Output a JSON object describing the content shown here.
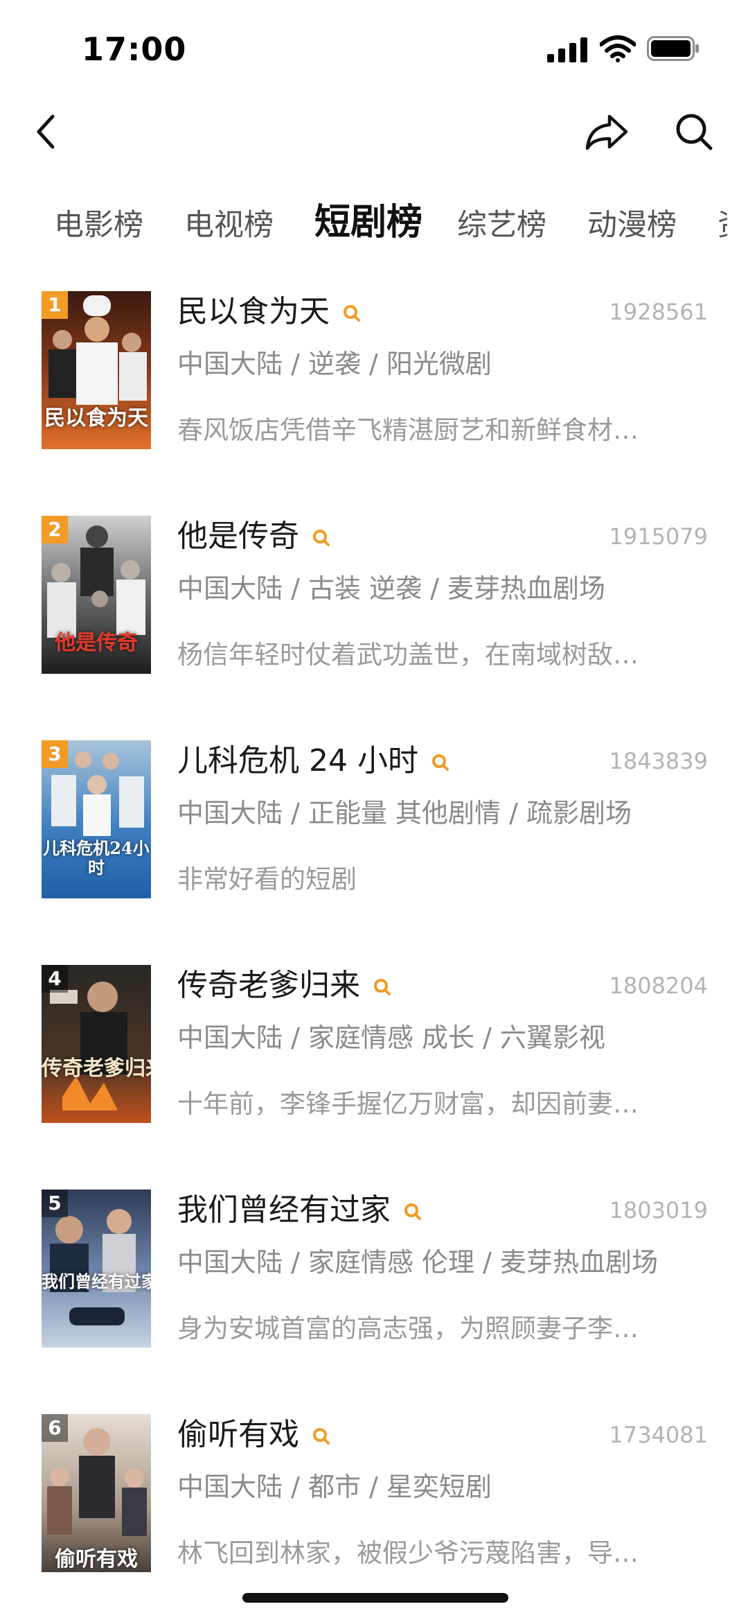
{
  "status_bar": {
    "time": "17:00"
  },
  "nav": {
    "back_icon": "chevron-left-icon",
    "share_icon": "share-icon",
    "search_icon": "search-icon"
  },
  "tabs": [
    {
      "label": "电影榜",
      "active": false
    },
    {
      "label": "电视榜",
      "active": false
    },
    {
      "label": "短剧榜",
      "active": true
    },
    {
      "label": "综艺榜",
      "active": false
    },
    {
      "label": "动漫榜",
      "active": false
    }
  ],
  "colors": {
    "accent": "#f29b26",
    "muted": "#8a8a8a",
    "score": "#b3b3b3"
  },
  "items": [
    {
      "rank": "1",
      "title": "民以食为天",
      "score": "1928561",
      "meta": "中国大陆 / 逆袭 / 阳光微剧",
      "desc": "春风饭店凭借辛飞精湛厨艺和新鲜食材…",
      "poster_caption": "民以食为天"
    },
    {
      "rank": "2",
      "title": "他是传奇",
      "score": "1915079",
      "meta": "中国大陆 / 古装 逆袭 / 麦芽热血剧场",
      "desc": "杨信年轻时仗着武功盖世，在南域树敌…",
      "poster_caption": "他是传奇"
    },
    {
      "rank": "3",
      "title": "儿科危机 24 小时",
      "score": "1843839",
      "meta": "中国大陆 / 正能量 其他剧情 / 疏影剧场",
      "desc": "非常好看的短剧",
      "poster_caption": "儿科危机24小时"
    },
    {
      "rank": "4",
      "title": "传奇老爹归来",
      "score": "1808204",
      "meta": "中国大陆 / 家庭情感 成长 / 六翼影视",
      "desc": "十年前，李锋手握亿万财富，却因前妻…",
      "poster_caption": "传奇老爹归来"
    },
    {
      "rank": "5",
      "title": "我们曾经有过家",
      "score": "1803019",
      "meta": "中国大陆 / 家庭情感 伦理 / 麦芽热血剧场",
      "desc": "身为安城首富的高志强，为照顾妻子李…",
      "poster_caption": "我们曾经有过家"
    },
    {
      "rank": "6",
      "title": "偷听有戏",
      "score": "1734081",
      "meta": "中国大陆 / 都市 / 星奕短剧",
      "desc": "林飞回到林家，被假少爷污蔑陷害，导…",
      "poster_caption": "偷听有戏"
    }
  ]
}
